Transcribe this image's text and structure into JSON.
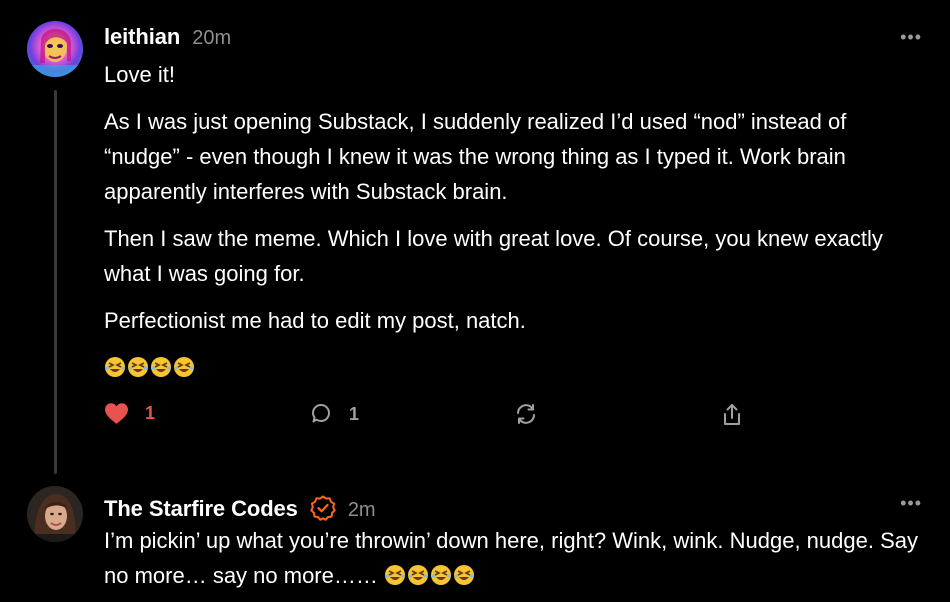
{
  "comments": [
    {
      "author": "leithian",
      "time": "20m",
      "more_label": "•••",
      "paragraphs": [
        "Love it!",
        "As I was just opening Substack, I suddenly realized I’d used “nod” instead of “nudge” - even though I knew it was the wrong thing as I typed it. Work brain apparently interferes with Substack brain.",
        "Then I saw the meme. Which I love with great love. Of course, you knew exactly what I was going for.",
        "Perfectionist me had to edit my post, natch."
      ],
      "reaction_emoji": "🤣🤣🤣🤣",
      "like_count": "1",
      "reply_count": "1"
    },
    {
      "author": "The Starfire Codes",
      "time": "2m",
      "more_label": "•••",
      "text": "I’m pickin’ up what you’re throwin’ down here, right? Wink, wink. Nudge, nudge. Say no more… say no more…… ",
      "reaction_emoji": "🤣🤣🤣🤣"
    }
  ],
  "colors": {
    "background": "#000000",
    "like": "#e8534f",
    "verified": "#ff6719",
    "muted": "#8e8e93"
  },
  "icons": [
    "heart-icon",
    "comment-icon",
    "restack-icon",
    "share-icon",
    "verified-badge-icon",
    "more-icon"
  ]
}
